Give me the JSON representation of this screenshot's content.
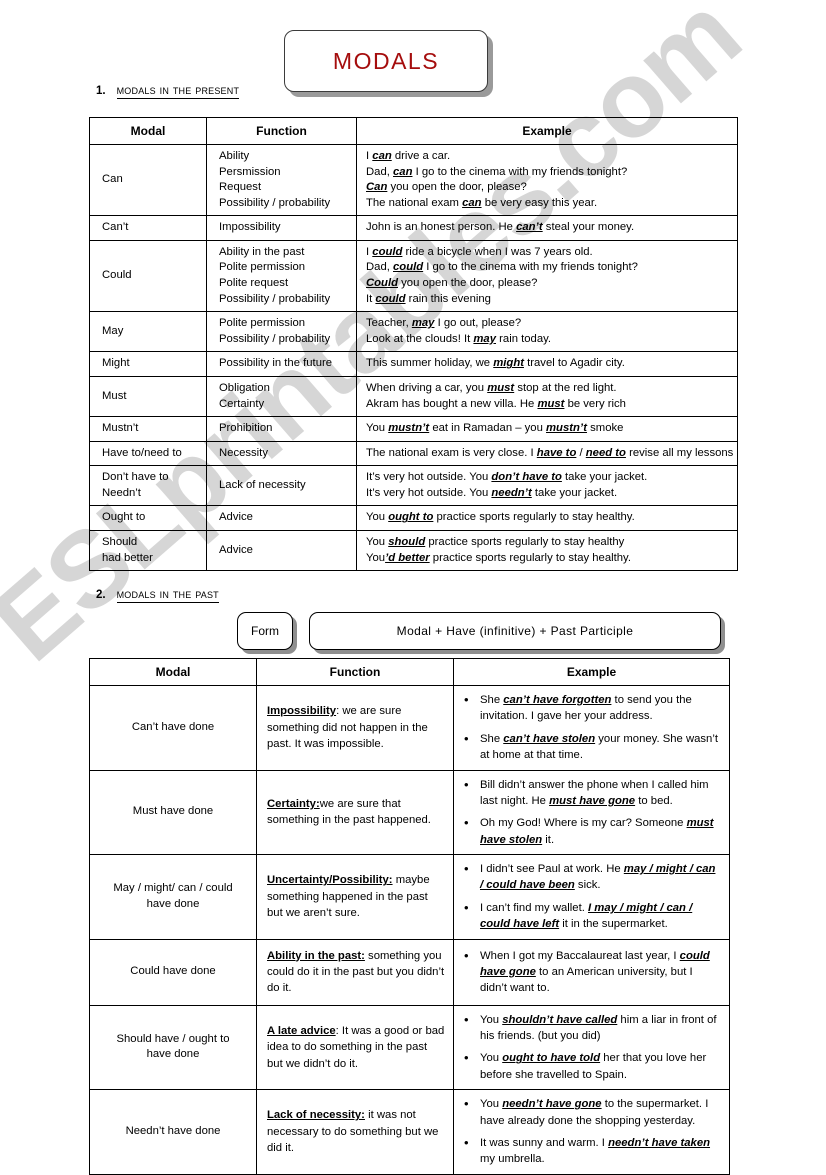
{
  "document": {
    "title": "MODALS",
    "title_color": "#a50d0d",
    "watermark": "ESLprintables.com"
  },
  "sections": [
    {
      "number": "1.",
      "label": "Modals in the present"
    },
    {
      "number": "2.",
      "label": "Modals in the past"
    }
  ],
  "form_box": {
    "label": "Form",
    "rule": "Modal  +  Have (infinitive)  +  Past Participle"
  },
  "table_present": {
    "headers": [
      "Modal",
      "Function",
      "Example"
    ],
    "rows": [
      {
        "modal": "Can",
        "functions": [
          "Ability",
          "Persmission",
          "Request",
          "Possibility / probability"
        ],
        "examples": [
          {
            "pre": "I ",
            "m": "can",
            "post": " drive a car."
          },
          {
            "pre": "Dad, ",
            "m": "can",
            "post": " I go to the cinema with my friends tonight?"
          },
          {
            "pre": "",
            "m": "Can",
            "post": " you open the door, please?"
          },
          {
            "pre": "The national exam ",
            "m": "can",
            "post": " be very easy this year."
          }
        ]
      },
      {
        "modal": "Can’t",
        "functions": [
          "Impossibility"
        ],
        "examples": [
          {
            "pre": "John is an honest person. He ",
            "m": "can’t",
            "post": " steal your money."
          }
        ]
      },
      {
        "modal": "Could",
        "functions": [
          "Ability in the past",
          "Polite permission",
          "Polite request",
          "Possibility / probability"
        ],
        "examples": [
          {
            "pre": "I ",
            "m": "could",
            "post": " ride a bicycle when I was 7 years old."
          },
          {
            "pre": "Dad, ",
            "m": "could",
            "post": " I go to the cinema with my friends tonight?"
          },
          {
            "pre": "",
            "m": "Could",
            "post": " you open the door, please?"
          },
          {
            "pre": "It ",
            "m": "could",
            "post": " rain this evening"
          }
        ]
      },
      {
        "modal": "May",
        "functions": [
          "Polite permission",
          "Possibility / probability"
        ],
        "examples": [
          {
            "pre": "Teacher, ",
            "m": "may",
            "post": " I go out, please?"
          },
          {
            "pre": "Look at the clouds! It ",
            "m": "may",
            "post": " rain today."
          }
        ]
      },
      {
        "modal": "Might",
        "functions": [
          "Possibility in the future"
        ],
        "examples": [
          {
            "pre": "This summer holiday, we ",
            "m": "might",
            "post": " travel to Agadir city."
          }
        ]
      },
      {
        "modal": "Must",
        "functions": [
          "Obligation",
          "Certainty"
        ],
        "examples": [
          {
            "pre": "When driving a car, you ",
            "m": "must",
            "post": " stop at the red light."
          },
          {
            "pre": "Akram has bought a new villa. He ",
            "m": "must",
            "post": " be very rich"
          }
        ]
      },
      {
        "modal": "Mustn’t",
        "functions": [
          "Prohibition"
        ],
        "examples": [
          {
            "pre": "You ",
            "m": "mustn’t",
            "post": " eat in Ramadan – you ",
            "m2": "mustn’t",
            "post2": " smoke"
          }
        ]
      },
      {
        "modal": "Have to/need to",
        "functions": [
          "Necessity"
        ],
        "examples": [
          {
            "pre": "The national exam is very close. I ",
            "m": "have to",
            "post": " / ",
            "m2": "need to",
            "post2": " revise all my lessons"
          }
        ]
      },
      {
        "modal": "Don’t have to\nNeedn’t",
        "modal_lines": [
          "Don’t have to",
          "Needn’t"
        ],
        "functions": [
          "Lack of necessity"
        ],
        "examples": [
          {
            "pre": "It’s very hot outside. You ",
            "m": "don’t have to",
            "post": " take your jacket."
          },
          {
            "pre": "It’s very hot outside. You ",
            "m": "needn’t",
            "post": " take your jacket."
          }
        ]
      },
      {
        "modal": "Ought to",
        "functions": [
          "Advice"
        ],
        "examples": [
          {
            "pre": "You ",
            "m": "ought to",
            "post": " practice sports regularly to stay healthy."
          }
        ]
      },
      {
        "modal": "Should\nhad better",
        "modal_lines": [
          "Should",
          "had better"
        ],
        "functions": [
          "Advice"
        ],
        "examples": [
          {
            "pre": "You ",
            "m": "should",
            "post": " practice sports regularly to stay healthy"
          },
          {
            "pre": "You",
            "m": "’d better",
            "post": " practice sports regularly to stay healthy."
          }
        ]
      }
    ]
  },
  "table_past": {
    "headers": [
      "Modal",
      "Function",
      "Example"
    ],
    "rows": [
      {
        "modal": "Can’t have done",
        "function_lead": "Impossibility",
        "function_sep": ": ",
        "function_rest": "we are sure something did not happen in the past. It was impossible.",
        "examples": [
          {
            "pre": "She ",
            "m": "can’t have forgotten",
            "post": " to send you the invitation. I gave her your address."
          },
          {
            "pre": "She ",
            "m": "can’t have stolen",
            "post": " your money. She wasn’t at home at that time."
          }
        ]
      },
      {
        "modal": "Must have done",
        "function_lead": "Certainty:",
        "function_sep": "",
        "function_rest": "we are sure that something in the past happened.",
        "examples": [
          {
            "pre": "Bill didn’t answer the phone when I called him last night. He ",
            "m": "must have gone",
            "post": " to bed."
          },
          {
            "pre": "Oh my God! Where is my car? Someone ",
            "m": "must have stolen",
            "post": " it."
          }
        ]
      },
      {
        "modal": "May / might/ can / could have done",
        "modal_lines": [
          "May / might/ can / could",
          "have done"
        ],
        "function_lead": "Uncertainty/Possibility:",
        "function_sep": " ",
        "function_rest": "maybe something happened in the past but we aren’t sure.",
        "examples": [
          {
            "pre": "I didn’t see Paul at work. He ",
            "m": "may / might / can / could have been",
            "post": " sick."
          },
          {
            "pre": "I can’t find my wallet. ",
            "m": "I may / might / can / could have left",
            "post": " it in the supermarket."
          }
        ]
      },
      {
        "modal": "Could have done",
        "function_lead": "Ability in the past:",
        "function_sep": " ",
        "function_rest": "something you could do it in the past but you didn’t do it.",
        "examples": [
          {
            "pre": "When I got my Baccalaureat last year, I ",
            "m": "could have gone",
            "post": " to an American university, but I didn’t want to."
          }
        ]
      },
      {
        "modal": "Should have / ought to have done",
        "modal_lines": [
          "Should have / ought to",
          "have done"
        ],
        "function_lead": "A late advice",
        "function_sep": ": ",
        "function_rest": "It was a good or bad idea to do something in the past but we didn’t do it.",
        "examples": [
          {
            "pre": "You ",
            "m": "shouldn’t have called",
            "post": " him a liar in front of his friends. (but you did)"
          },
          {
            "pre": "You ",
            "m": "ought to have told",
            "post": " her that you love her before she travelled to Spain."
          }
        ]
      },
      {
        "modal": "Needn’t have done",
        "function_lead": "Lack of necessity:",
        "function_sep": " ",
        "function_rest": "it was not necessary to do something but we did it.",
        "examples": [
          {
            "pre": "You ",
            "m": "needn’t have gone",
            "post": " to the supermarket. I have already done the shopping yesterday."
          },
          {
            "pre": "It was sunny and warm. I ",
            "m": "needn’t have taken",
            "post": " my umbrella."
          }
        ]
      }
    ]
  }
}
